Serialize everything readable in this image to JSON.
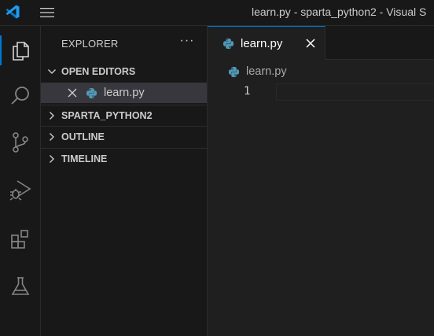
{
  "titlebar": {
    "logo_icon": "vscode-logo-icon",
    "menu_icon": "hamburger-menu-icon",
    "window_title": "learn.py - sparta_python2 - Visual S"
  },
  "activity_bar": {
    "items": [
      {
        "name": "explorer",
        "icon": "files-icon",
        "active": true
      },
      {
        "name": "search",
        "icon": "search-icon",
        "active": false
      },
      {
        "name": "source-control",
        "icon": "source-control-icon",
        "active": false
      },
      {
        "name": "run-and-debug",
        "icon": "run-debug-icon",
        "active": false
      },
      {
        "name": "extensions",
        "icon": "extensions-icon",
        "active": false
      },
      {
        "name": "testing",
        "icon": "flask-icon",
        "active": false
      }
    ]
  },
  "sidebar": {
    "title": "EXPLORER",
    "more_icon": "ellipsis-icon",
    "open_editors": {
      "label": "OPEN EDITORS",
      "expanded": true,
      "files": [
        {
          "name": "learn.py",
          "icon": "python-icon"
        }
      ]
    },
    "sections": [
      {
        "label": "SPARTA_PYTHON2",
        "expanded": false
      },
      {
        "label": "OUTLINE",
        "expanded": false
      },
      {
        "label": "TIMELINE",
        "expanded": false
      }
    ]
  },
  "editor": {
    "tabs": [
      {
        "label": "learn.py",
        "icon": "python-icon",
        "active": true
      }
    ],
    "breadcrumb": {
      "file": "learn.py"
    },
    "line_numbers": [
      "1"
    ]
  },
  "colors": {
    "accent": "#0078d4",
    "python_blue": "#519aba",
    "background": "#1f1f1f",
    "sidebar_bg": "#181818"
  }
}
